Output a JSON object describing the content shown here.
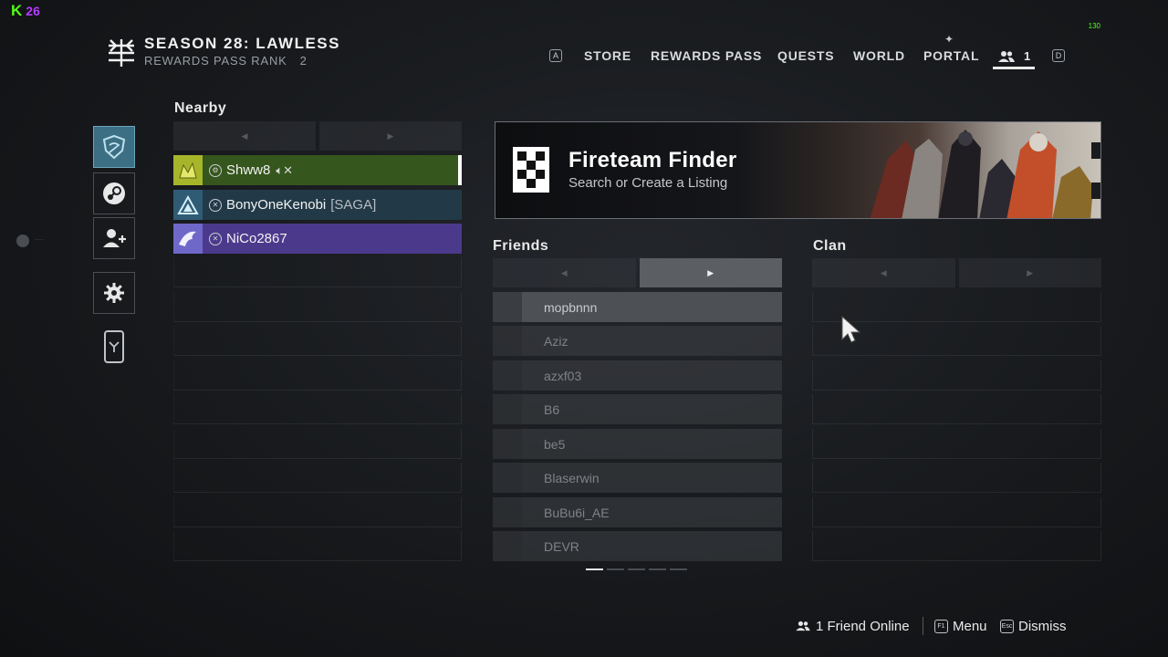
{
  "overlay": {
    "kick_logo": "K",
    "viewer_count": "26",
    "fps": "130"
  },
  "season": {
    "title": "SEASON 28: LAWLESS",
    "rank_label": "REWARDS PASS RANK",
    "rank_value": "2"
  },
  "nav": {
    "key_left": "A",
    "items": [
      "STORE",
      "REWARDS PASS",
      "QUESTS",
      "WORLD",
      "PORTAL"
    ],
    "social_count": "1",
    "key_right": "D"
  },
  "nearby": {
    "title": "Nearby",
    "players": [
      {
        "name": "Shww8",
        "tag": "",
        "platform": "steam",
        "muted": true
      },
      {
        "name": "BonyOneKenobi",
        "tag": "[SAGA]",
        "platform": "xbox",
        "muted": false
      },
      {
        "name": "NiCo2867",
        "tag": "",
        "platform": "xbox",
        "muted": false
      }
    ]
  },
  "fireteam_finder": {
    "title": "Fireteam Finder",
    "subtitle": "Search or Create a Listing"
  },
  "friends": {
    "title": "Friends",
    "names": [
      "mopbnnn",
      "Aziz",
      "azxf03",
      "B6",
      "be5",
      "Blaserwin",
      "BuBu6i_AE",
      "DEVR"
    ]
  },
  "clan": {
    "title": "Clan"
  },
  "pagination": {
    "pages": 5,
    "current": 1
  },
  "footer": {
    "friends_online": "1 Friend Online",
    "menu_key": "F1",
    "menu_label": "Menu",
    "dismiss_key": "Esc",
    "dismiss_label": "Dismiss"
  },
  "colors": {
    "nearby_steam_row": "#35561c",
    "nearby_xbox_row": "#223a47",
    "nearby_selected_row": "#4b3a8c",
    "rail_active": "#3d6f84"
  },
  "icons": [
    "season-emblem-icon",
    "friends-icon",
    "shield-emblem-icon",
    "steam-icon",
    "add-friend-icon",
    "gear-icon",
    "phone-icon",
    "speaker-muted-icon",
    "xbox-icon",
    "fireteam-finder-icon",
    "mouse-cursor-icon"
  ]
}
